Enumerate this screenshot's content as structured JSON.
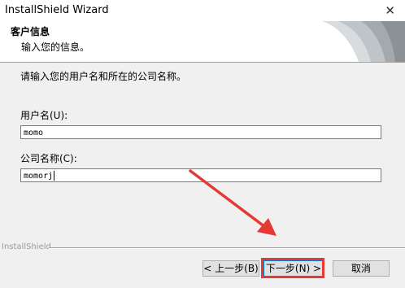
{
  "window": {
    "title": "InstallShield Wizard",
    "close_glyph": "✕"
  },
  "header": {
    "title": "客户信息",
    "subtitle": "输入您的信息。"
  },
  "body": {
    "intro": "请输入您的用户名和所在的公司名称。",
    "user_label": "用户名(U):",
    "user_value": "momo",
    "company_label": "公司名称(C):",
    "company_value": "momorj"
  },
  "footer": {
    "brand": "InstallShield",
    "back_label": "< 上一步(B)",
    "next_label": "下一步(N) >",
    "cancel_label": "取消"
  },
  "annotation": {
    "color": "#e53935"
  }
}
